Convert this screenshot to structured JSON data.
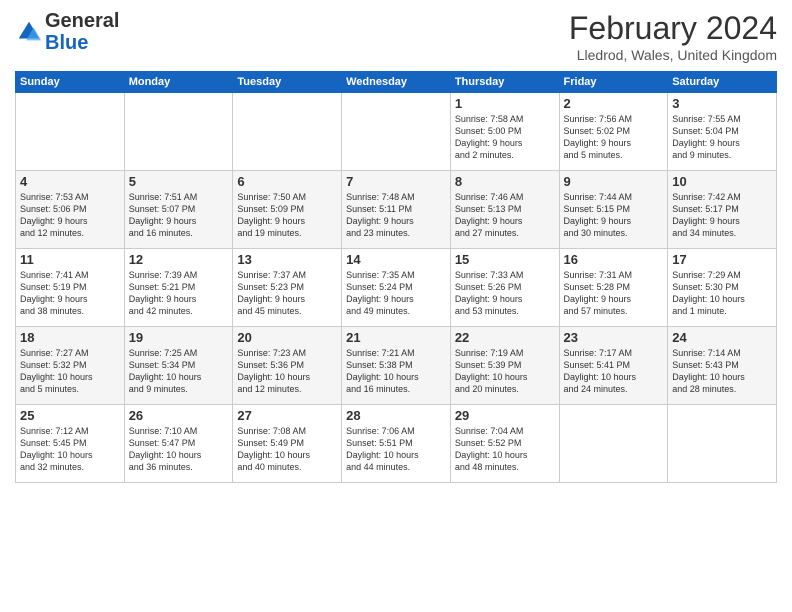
{
  "header": {
    "logo_general": "General",
    "logo_blue": "Blue",
    "month_year": "February 2024",
    "location": "Lledrod, Wales, United Kingdom"
  },
  "days_of_week": [
    "Sunday",
    "Monday",
    "Tuesday",
    "Wednesday",
    "Thursday",
    "Friday",
    "Saturday"
  ],
  "weeks": [
    [
      {
        "day": "",
        "info": ""
      },
      {
        "day": "",
        "info": ""
      },
      {
        "day": "",
        "info": ""
      },
      {
        "day": "",
        "info": ""
      },
      {
        "day": "1",
        "info": "Sunrise: 7:58 AM\nSunset: 5:00 PM\nDaylight: 9 hours\nand 2 minutes."
      },
      {
        "day": "2",
        "info": "Sunrise: 7:56 AM\nSunset: 5:02 PM\nDaylight: 9 hours\nand 5 minutes."
      },
      {
        "day": "3",
        "info": "Sunrise: 7:55 AM\nSunset: 5:04 PM\nDaylight: 9 hours\nand 9 minutes."
      }
    ],
    [
      {
        "day": "4",
        "info": "Sunrise: 7:53 AM\nSunset: 5:06 PM\nDaylight: 9 hours\nand 12 minutes."
      },
      {
        "day": "5",
        "info": "Sunrise: 7:51 AM\nSunset: 5:07 PM\nDaylight: 9 hours\nand 16 minutes."
      },
      {
        "day": "6",
        "info": "Sunrise: 7:50 AM\nSunset: 5:09 PM\nDaylight: 9 hours\nand 19 minutes."
      },
      {
        "day": "7",
        "info": "Sunrise: 7:48 AM\nSunset: 5:11 PM\nDaylight: 9 hours\nand 23 minutes."
      },
      {
        "day": "8",
        "info": "Sunrise: 7:46 AM\nSunset: 5:13 PM\nDaylight: 9 hours\nand 27 minutes."
      },
      {
        "day": "9",
        "info": "Sunrise: 7:44 AM\nSunset: 5:15 PM\nDaylight: 9 hours\nand 30 minutes."
      },
      {
        "day": "10",
        "info": "Sunrise: 7:42 AM\nSunset: 5:17 PM\nDaylight: 9 hours\nand 34 minutes."
      }
    ],
    [
      {
        "day": "11",
        "info": "Sunrise: 7:41 AM\nSunset: 5:19 PM\nDaylight: 9 hours\nand 38 minutes."
      },
      {
        "day": "12",
        "info": "Sunrise: 7:39 AM\nSunset: 5:21 PM\nDaylight: 9 hours\nand 42 minutes."
      },
      {
        "day": "13",
        "info": "Sunrise: 7:37 AM\nSunset: 5:23 PM\nDaylight: 9 hours\nand 45 minutes."
      },
      {
        "day": "14",
        "info": "Sunrise: 7:35 AM\nSunset: 5:24 PM\nDaylight: 9 hours\nand 49 minutes."
      },
      {
        "day": "15",
        "info": "Sunrise: 7:33 AM\nSunset: 5:26 PM\nDaylight: 9 hours\nand 53 minutes."
      },
      {
        "day": "16",
        "info": "Sunrise: 7:31 AM\nSunset: 5:28 PM\nDaylight: 9 hours\nand 57 minutes."
      },
      {
        "day": "17",
        "info": "Sunrise: 7:29 AM\nSunset: 5:30 PM\nDaylight: 10 hours\nand 1 minute."
      }
    ],
    [
      {
        "day": "18",
        "info": "Sunrise: 7:27 AM\nSunset: 5:32 PM\nDaylight: 10 hours\nand 5 minutes."
      },
      {
        "day": "19",
        "info": "Sunrise: 7:25 AM\nSunset: 5:34 PM\nDaylight: 10 hours\nand 9 minutes."
      },
      {
        "day": "20",
        "info": "Sunrise: 7:23 AM\nSunset: 5:36 PM\nDaylight: 10 hours\nand 12 minutes."
      },
      {
        "day": "21",
        "info": "Sunrise: 7:21 AM\nSunset: 5:38 PM\nDaylight: 10 hours\nand 16 minutes."
      },
      {
        "day": "22",
        "info": "Sunrise: 7:19 AM\nSunset: 5:39 PM\nDaylight: 10 hours\nand 20 minutes."
      },
      {
        "day": "23",
        "info": "Sunrise: 7:17 AM\nSunset: 5:41 PM\nDaylight: 10 hours\nand 24 minutes."
      },
      {
        "day": "24",
        "info": "Sunrise: 7:14 AM\nSunset: 5:43 PM\nDaylight: 10 hours\nand 28 minutes."
      }
    ],
    [
      {
        "day": "25",
        "info": "Sunrise: 7:12 AM\nSunset: 5:45 PM\nDaylight: 10 hours\nand 32 minutes."
      },
      {
        "day": "26",
        "info": "Sunrise: 7:10 AM\nSunset: 5:47 PM\nDaylight: 10 hours\nand 36 minutes."
      },
      {
        "day": "27",
        "info": "Sunrise: 7:08 AM\nSunset: 5:49 PM\nDaylight: 10 hours\nand 40 minutes."
      },
      {
        "day": "28",
        "info": "Sunrise: 7:06 AM\nSunset: 5:51 PM\nDaylight: 10 hours\nand 44 minutes."
      },
      {
        "day": "29",
        "info": "Sunrise: 7:04 AM\nSunset: 5:52 PM\nDaylight: 10 hours\nand 48 minutes."
      },
      {
        "day": "",
        "info": ""
      },
      {
        "day": "",
        "info": ""
      }
    ]
  ]
}
